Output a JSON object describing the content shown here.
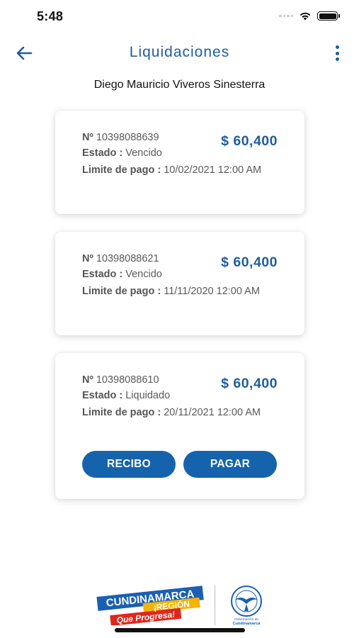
{
  "status_bar": {
    "time": "5:48"
  },
  "header": {
    "title": "Liquidaciones"
  },
  "user": {
    "name": "Diego Mauricio Viveros Sinesterra"
  },
  "labels": {
    "number_prefix": "Nº",
    "estado": "Estado :",
    "limite": "Limite de pago :"
  },
  "cards": [
    {
      "number": "10398088639",
      "amount": "$ 60,400",
      "estado": "Vencido",
      "limite": "10/02/2021 12:00 AM"
    },
    {
      "number": "10398088621",
      "amount": "$ 60,400",
      "estado": "Vencido",
      "limite": "11/11/2020 12:00 AM"
    },
    {
      "number": "10398088610",
      "amount": "$ 60,400",
      "estado": "Liquidado",
      "limite": "20/11/2021 12:00 AM",
      "buttons": {
        "recibo": "RECIBO",
        "pagar": "PAGAR"
      }
    }
  ],
  "footer": {
    "logo_cund_line1": "CUNDINAMARCA",
    "logo_cund_line2": "¡REGIÓN",
    "logo_cund_line3": "Que Progresa!",
    "logo_gob_text1": "Gobernación de",
    "logo_gob_text2": "Cundinamarca"
  },
  "colors": {
    "primary": "#1f5e9f",
    "button": "#1663ad",
    "text": "#5a5a5a"
  },
  "icons": {
    "back": "arrow-left-icon",
    "menu": "more-vert-icon",
    "wifi": "wifi-icon",
    "battery": "battery-icon",
    "signal": "signal-icon"
  }
}
